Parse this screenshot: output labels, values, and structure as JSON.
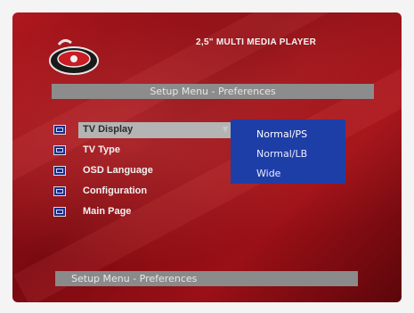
{
  "brand": "2,5\" MULTI MEDIA PLAYER",
  "header_title": "Setup Menu - Preferences",
  "footer_title": "Setup Menu - Preferences",
  "menu_items": [
    {
      "label": "TV Display",
      "icon": "tv-display-icon"
    },
    {
      "label": "TV Type",
      "icon": "tv-type-icon"
    },
    {
      "label": "OSD Language",
      "icon": "language-icon"
    },
    {
      "label": "Configuration",
      "icon": "configuration-icon"
    },
    {
      "label": "Main Page",
      "icon": "return-icon"
    }
  ],
  "selected_menu_item": "TV Display",
  "submenu_options": [
    "Normal/PS",
    "Normal/LB",
    "Wide"
  ],
  "selected_option": "Normal/PS",
  "colors": {
    "background": "#8e0f15",
    "submenu": "#1e3ea7",
    "highlight": "#b4b4b4",
    "title_bar": "#8c8c8c"
  }
}
